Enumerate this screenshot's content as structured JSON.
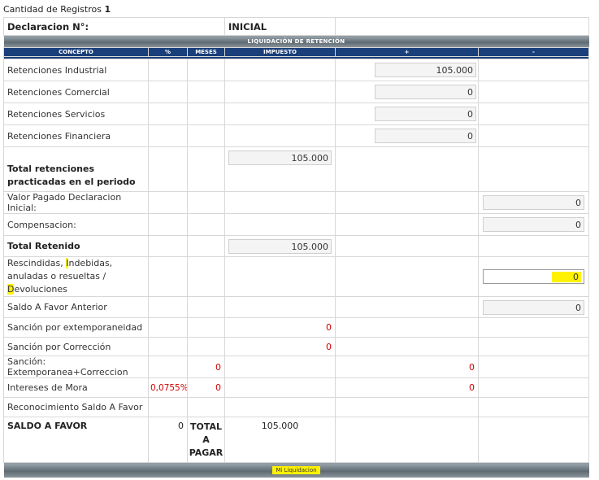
{
  "header": {
    "reg_label": "Cantidad de Registros",
    "reg_count": "1"
  },
  "decl": {
    "label": "Declaracion N°:",
    "inicial": "INICIAL"
  },
  "band_title": "LIQUIDACIÓN DE RETENCIÓN",
  "columns": {
    "concepto": "CONCEPTO",
    "pct": "%",
    "meses": "MESES",
    "impuesto": "IMPUESTO",
    "plus": "+",
    "minus": "-"
  },
  "rows": {
    "ret_industrial": {
      "label": "Retenciones Industrial",
      "plus": "105.000"
    },
    "ret_comercial": {
      "label": "Retenciones Comercial",
      "plus": "0"
    },
    "ret_servicios": {
      "label": "Retenciones Servicios",
      "plus": "0"
    },
    "ret_financiera": {
      "label": "Retenciones Financiera",
      "plus": "0"
    },
    "total_ret": {
      "label": "Total retenciones practicadas en el periodo",
      "impuesto": "105.000"
    },
    "valor_pagado": {
      "label": "Valor Pagado Declaracion Inicial:",
      "minus": "0"
    },
    "compensacion": {
      "label": "Compensacion:",
      "minus": "0"
    },
    "total_retenido": {
      "label": "Total Retenido",
      "impuesto": "105.000"
    },
    "rescindidas": {
      "w1": "Rescindidas, ",
      "h1": "I",
      "w2": "ndebidas, anuladas o resueltas / ",
      "h2": "D",
      "w3": "evoluciones",
      "minus": "0"
    },
    "saldo_anterior": {
      "label": "Saldo A Favor Anterior",
      "minus": "0"
    },
    "sancion_ext": {
      "label": "Sanción por  extemporaneidad",
      "impuesto": "0"
    },
    "sancion_corr": {
      "label": "Sanción por Corrección",
      "impuesto": "0"
    },
    "sancion_both": {
      "label": "Sanción: Extemporanea+Correccion",
      "meses": "0",
      "plus": "0"
    },
    "intereses": {
      "label": "Intereses de Mora",
      "pct": "0,0755%",
      "meses": "0",
      "plus": "0"
    },
    "reconocimiento": {
      "label": "Reconocimiento Saldo A Favor"
    },
    "saldo_favor": {
      "label": "SALDO A FAVOR",
      "pct": "0",
      "total_pagar": "TOTAL A PAGAR",
      "impuesto": "105.000"
    }
  },
  "footer": {
    "button": "Mi Liquidacion"
  }
}
